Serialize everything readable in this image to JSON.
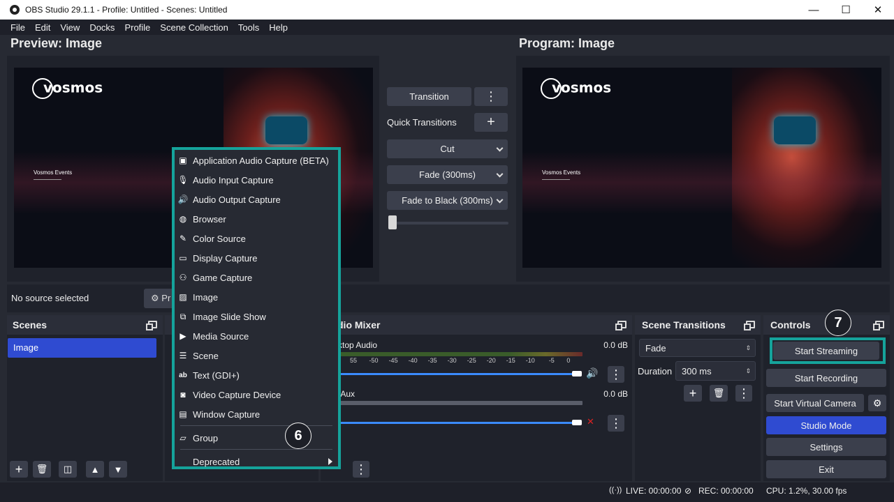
{
  "window": {
    "title": "OBS Studio 29.1.1 - Profile: Untitled - Scenes: Untitled",
    "minimize": "—",
    "maximize": "☐",
    "close": "✕"
  },
  "menu": [
    "File",
    "Edit",
    "View",
    "Docks",
    "Profile",
    "Scene Collection",
    "Tools",
    "Help"
  ],
  "preview": {
    "title": "Preview: Image",
    "logo": "vosmos",
    "event": "Vosmos Events"
  },
  "program": {
    "title": "Program: Image",
    "logo": "vosmos",
    "event": "Vosmos Events"
  },
  "transitions": {
    "transition_button": "Transition",
    "quick_label": "Quick Transitions",
    "options": [
      "Cut",
      "Fade (300ms)",
      "Fade to Black (300ms)"
    ]
  },
  "source_bar": {
    "status": "No source selected",
    "properties_label": "Pr"
  },
  "scenes": {
    "title": "Scenes",
    "items": [
      "Image"
    ]
  },
  "mixer": {
    "title": "dio Mixer",
    "channels": [
      {
        "name": "ktop Audio",
        "db": "0.0 dB",
        "muted": false
      },
      {
        "name": "/Aux",
        "db": "0.0 dB",
        "muted": true
      }
    ],
    "ticks": [
      "55",
      "-50",
      "-45",
      "-40",
      "-35",
      "-30",
      "-25",
      "-20",
      "-15",
      "-10",
      "-5",
      "0"
    ]
  },
  "scene_transitions": {
    "title": "Scene Transitions",
    "selected": "Fade",
    "duration_label": "Duration",
    "duration_value": "300 ms"
  },
  "controls": {
    "title": "Controls",
    "start_streaming": "Start Streaming",
    "start_recording": "Start Recording",
    "start_virtual_camera": "Start Virtual Camera",
    "studio_mode": "Studio Mode",
    "settings": "Settings",
    "exit": "Exit"
  },
  "context_menu": {
    "items": [
      {
        "label": "Application Audio Capture (BETA)",
        "icon": "app-audio-icon"
      },
      {
        "label": "Audio Input Capture",
        "icon": "microphone-icon"
      },
      {
        "label": "Audio Output Capture",
        "icon": "speaker-icon"
      },
      {
        "label": "Browser",
        "icon": "globe-icon"
      },
      {
        "label": "Color Source",
        "icon": "brush-icon"
      },
      {
        "label": "Display Capture",
        "icon": "monitor-icon"
      },
      {
        "label": "Game Capture",
        "icon": "gamepad-icon"
      },
      {
        "label": "Image",
        "icon": "image-icon"
      },
      {
        "label": "Image Slide Show",
        "icon": "slideshow-icon"
      },
      {
        "label": "Media Source",
        "icon": "play-icon"
      },
      {
        "label": "Scene",
        "icon": "list-icon"
      },
      {
        "label": "Text (GDI+)",
        "icon": "text-icon"
      },
      {
        "label": "Video Capture Device",
        "icon": "camera-icon"
      },
      {
        "label": "Window Capture",
        "icon": "window-icon"
      }
    ],
    "group": "Group",
    "deprecated": "Deprecated"
  },
  "callouts": {
    "six": "6",
    "seven": "7"
  },
  "footer": {
    "live": "LIVE: 00:00:00",
    "rec": "REC: 00:00:00",
    "cpu": "CPU: 1.2%, 30.00 fps"
  },
  "colors": {
    "accent_blue": "#2f4bd1",
    "highlight_teal": "#15a39b",
    "background": "#272a33"
  }
}
